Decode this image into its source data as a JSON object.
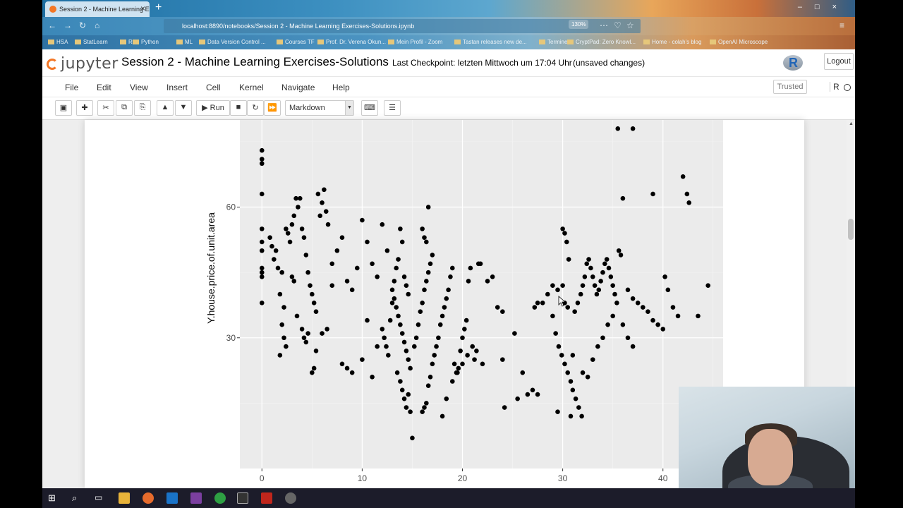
{
  "browser": {
    "tab_title": "Session 2 - Machine Learning E...",
    "url": "localhost:8890/notebooks/Session 2 - Machine Learning Exercises-Solutions.ipynb",
    "zoom": "130%",
    "bookmarks": [
      "HSA",
      "StatLearn",
      "R",
      "Python",
      "ML",
      "Data Version Control ...",
      "Courses TF",
      "Prof. Dr. Verena Okun...",
      "Mein Profil - Zoom",
      "Tastan releases new de...",
      "Termine",
      "CryptPad: Zero Knowl...",
      "Home - colah's blog",
      "OpenAI Microscope"
    ]
  },
  "jupyter": {
    "logo_text": "jupyter",
    "notebook_title": "Session 2 - Machine Learning Exercises-Solutions",
    "checkpoint": "Last Checkpoint: letzten Mittwoch um 17:04 Uhr",
    "unsaved": "(unsaved changes)",
    "logout_label": "Logout",
    "trusted_label": "Trusted",
    "kernel_name": "R",
    "r_logo": "R"
  },
  "menu": [
    "File",
    "Edit",
    "View",
    "Insert",
    "Cell",
    "Kernel",
    "Navigate",
    "Help"
  ],
  "toolbar": {
    "run_label": "Run",
    "cell_type": "Markdown"
  },
  "chart_data": {
    "type": "scatter",
    "ylabel": "Y.house.price.of.unit.area",
    "xlabel": "",
    "x_ticks": [
      "0",
      "10",
      "20",
      "30",
      "40"
    ],
    "y_ticks": [
      "30",
      "60"
    ],
    "xlim": [
      -2.2,
      46
    ],
    "ylim": [
      0,
      80
    ],
    "grid": true,
    "points": [
      [
        0,
        73
      ],
      [
        0,
        71
      ],
      [
        0,
        70
      ],
      [
        0,
        63
      ],
      [
        0,
        55
      ],
      [
        0,
        52
      ],
      [
        0,
        50
      ],
      [
        0,
        46
      ],
      [
        0,
        45
      ],
      [
        0,
        44
      ],
      [
        0,
        38
      ],
      [
        0.8,
        53
      ],
      [
        1,
        51
      ],
      [
        1.2,
        48
      ],
      [
        1.4,
        50
      ],
      [
        1.6,
        46
      ],
      [
        1.8,
        40
      ],
      [
        2,
        45
      ],
      [
        2.2,
        37
      ],
      [
        2.4,
        55
      ],
      [
        2.6,
        54
      ],
      [
        2.8,
        52
      ],
      [
        3,
        56
      ],
      [
        3.2,
        58
      ],
      [
        3.4,
        62
      ],
      [
        3.6,
        60
      ],
      [
        3.8,
        62
      ],
      [
        4,
        55
      ],
      [
        4.2,
        53
      ],
      [
        4.4,
        49
      ],
      [
        4.6,
        45
      ],
      [
        4.8,
        42
      ],
      [
        5,
        40
      ],
      [
        5.2,
        38
      ],
      [
        5.4,
        36
      ],
      [
        5.6,
        63
      ],
      [
        5.8,
        58
      ],
      [
        6,
        61
      ],
      [
        6.2,
        64
      ],
      [
        6.4,
        59
      ],
      [
        6.6,
        56
      ],
      [
        2,
        33
      ],
      [
        2.2,
        30
      ],
      [
        2.4,
        28
      ],
      [
        1.8,
        26
      ],
      [
        3,
        44
      ],
      [
        3.2,
        43
      ],
      [
        3.5,
        35
      ],
      [
        4,
        32
      ],
      [
        4.2,
        30
      ],
      [
        4.4,
        29
      ],
      [
        4.6,
        31
      ],
      [
        5,
        22
      ],
      [
        5.2,
        23
      ],
      [
        5.4,
        27
      ],
      [
        6,
        31
      ],
      [
        6.5,
        32
      ],
      [
        7,
        42
      ],
      [
        7,
        47
      ],
      [
        7.5,
        50
      ],
      [
        8,
        53
      ],
      [
        8.5,
        43
      ],
      [
        9,
        41
      ],
      [
        9.5,
        46
      ],
      [
        10,
        57
      ],
      [
        10.5,
        52
      ],
      [
        8,
        24
      ],
      [
        8.5,
        23
      ],
      [
        9,
        22
      ],
      [
        10,
        25
      ],
      [
        10.5,
        34
      ],
      [
        11,
        21
      ],
      [
        11.5,
        28
      ],
      [
        11,
        47
      ],
      [
        11.5,
        44
      ],
      [
        12,
        56
      ],
      [
        12.5,
        50
      ],
      [
        13,
        41
      ],
      [
        13.2,
        39
      ],
      [
        13.4,
        37
      ],
      [
        13.6,
        35
      ],
      [
        13.8,
        33
      ],
      [
        14,
        31
      ],
      [
        14.2,
        29
      ],
      [
        14.4,
        27
      ],
      [
        14.6,
        25
      ],
      [
        14.8,
        23
      ],
      [
        12,
        32
      ],
      [
        12.2,
        30
      ],
      [
        12.4,
        28
      ],
      [
        12.6,
        26
      ],
      [
        12.8,
        34
      ],
      [
        13,
        38
      ],
      [
        13.2,
        43
      ],
      [
        13.4,
        46
      ],
      [
        13.6,
        48
      ],
      [
        13.8,
        55
      ],
      [
        14,
        52
      ],
      [
        14.2,
        44
      ],
      [
        14.4,
        42
      ],
      [
        14.6,
        40
      ],
      [
        13.5,
        22
      ],
      [
        13.8,
        20
      ],
      [
        14,
        18
      ],
      [
        14.2,
        16
      ],
      [
        14.4,
        14
      ],
      [
        14.6,
        17
      ],
      [
        14.8,
        13
      ],
      [
        15,
        7
      ],
      [
        15.2,
        28
      ],
      [
        15.4,
        30
      ],
      [
        15.6,
        33
      ],
      [
        15.8,
        36
      ],
      [
        16,
        38
      ],
      [
        16.2,
        41
      ],
      [
        16.4,
        43
      ],
      [
        16.6,
        45
      ],
      [
        16.8,
        47
      ],
      [
        17,
        49
      ],
      [
        16,
        55
      ],
      [
        16.2,
        53
      ],
      [
        16.4,
        52
      ],
      [
        16.6,
        60
      ],
      [
        16,
        13
      ],
      [
        16.2,
        14
      ],
      [
        16.4,
        15
      ],
      [
        16.6,
        19
      ],
      [
        16.8,
        21
      ],
      [
        17,
        24
      ],
      [
        17.2,
        26
      ],
      [
        17.4,
        28
      ],
      [
        17.6,
        30
      ],
      [
        17.8,
        33
      ],
      [
        18,
        35
      ],
      [
        18.2,
        37
      ],
      [
        18.4,
        39
      ],
      [
        18.6,
        41
      ],
      [
        18.8,
        44
      ],
      [
        19,
        46
      ],
      [
        19.2,
        24
      ],
      [
        19.4,
        22
      ],
      [
        19.6,
        23
      ],
      [
        19.8,
        27
      ],
      [
        20,
        30
      ],
      [
        20.2,
        32
      ],
      [
        20.4,
        34
      ],
      [
        20.6,
        43
      ],
      [
        20.8,
        46
      ],
      [
        18,
        12
      ],
      [
        18.4,
        16
      ],
      [
        19,
        20
      ],
      [
        19.5,
        22
      ],
      [
        20,
        24
      ],
      [
        20.5,
        26
      ],
      [
        21,
        28
      ],
      [
        21.2,
        25
      ],
      [
        21.4,
        27
      ],
      [
        21.6,
        47
      ],
      [
        21.8,
        47
      ],
      [
        22,
        24
      ],
      [
        22.5,
        43
      ],
      [
        23,
        44
      ],
      [
        23.5,
        37
      ],
      [
        24,
        36
      ],
      [
        24,
        25
      ],
      [
        24.2,
        14
      ],
      [
        25.2,
        31
      ],
      [
        25.5,
        16
      ],
      [
        26,
        22
      ],
      [
        26.5,
        17
      ],
      [
        27,
        18
      ],
      [
        27.5,
        17
      ],
      [
        27.2,
        37
      ],
      [
        27.5,
        38
      ],
      [
        28,
        38
      ],
      [
        28.5,
        40
      ],
      [
        29,
        42
      ],
      [
        29.5,
        41
      ],
      [
        30,
        55
      ],
      [
        30.2,
        54
      ],
      [
        30.4,
        52
      ],
      [
        30.6,
        48
      ],
      [
        30,
        42
      ],
      [
        30.2,
        38
      ],
      [
        30.5,
        37
      ],
      [
        29,
        35
      ],
      [
        29.3,
        31
      ],
      [
        29.6,
        28
      ],
      [
        29.9,
        26
      ],
      [
        30.2,
        24
      ],
      [
        30.5,
        22
      ],
      [
        30.8,
        20
      ],
      [
        31,
        18
      ],
      [
        31.3,
        16
      ],
      [
        31.6,
        14
      ],
      [
        31.9,
        12
      ],
      [
        29.5,
        13
      ],
      [
        30.8,
        12
      ],
      [
        31,
        26
      ],
      [
        31.2,
        36
      ],
      [
        31.5,
        38
      ],
      [
        31.8,
        40
      ],
      [
        32,
        42
      ],
      [
        32.2,
        44
      ],
      [
        32.4,
        47
      ],
      [
        32.6,
        48
      ],
      [
        32.8,
        46
      ],
      [
        33,
        44
      ],
      [
        33.2,
        42
      ],
      [
        33.4,
        40
      ],
      [
        33.6,
        41
      ],
      [
        33.8,
        43
      ],
      [
        34,
        45
      ],
      [
        34.2,
        47
      ],
      [
        34.4,
        48
      ],
      [
        34.6,
        46
      ],
      [
        34.8,
        44
      ],
      [
        35,
        42
      ],
      [
        35.2,
        40
      ],
      [
        35.4,
        38
      ],
      [
        35.6,
        50
      ],
      [
        35.8,
        49
      ],
      [
        36,
        62
      ],
      [
        35.5,
        78
      ],
      [
        37,
        78
      ],
      [
        36.5,
        41
      ],
      [
        37,
        39
      ],
      [
        37.5,
        38
      ],
      [
        38,
        37
      ],
      [
        38.5,
        36
      ],
      [
        39,
        34
      ],
      [
        39.5,
        33
      ],
      [
        40,
        32
      ],
      [
        40.2,
        44
      ],
      [
        40.5,
        41
      ],
      [
        41,
        37
      ],
      [
        41.5,
        35
      ],
      [
        42,
        67
      ],
      [
        42.4,
        63
      ],
      [
        42.6,
        61
      ],
      [
        43.5,
        35
      ],
      [
        44.5,
        42
      ],
      [
        39,
        63
      ],
      [
        33,
        25
      ],
      [
        33.5,
        28
      ],
      [
        34,
        30
      ],
      [
        34.5,
        33
      ],
      [
        35,
        35
      ],
      [
        32,
        22
      ],
      [
        32.5,
        21
      ],
      [
        36,
        33
      ],
      [
        36.5,
        30
      ],
      [
        37,
        28
      ]
    ]
  },
  "colors": {
    "accent": "#f37726",
    "plot_bg": "#ebebeb",
    "point": "#000000"
  },
  "icons": [
    "save-icon",
    "plus-icon",
    "scissors-icon",
    "copy-icon",
    "paste-icon",
    "arrow-up-icon",
    "arrow-down-icon",
    "play-icon",
    "stop-icon",
    "restart-icon",
    "fast-forward-icon",
    "keyboard-icon",
    "list-icon"
  ]
}
